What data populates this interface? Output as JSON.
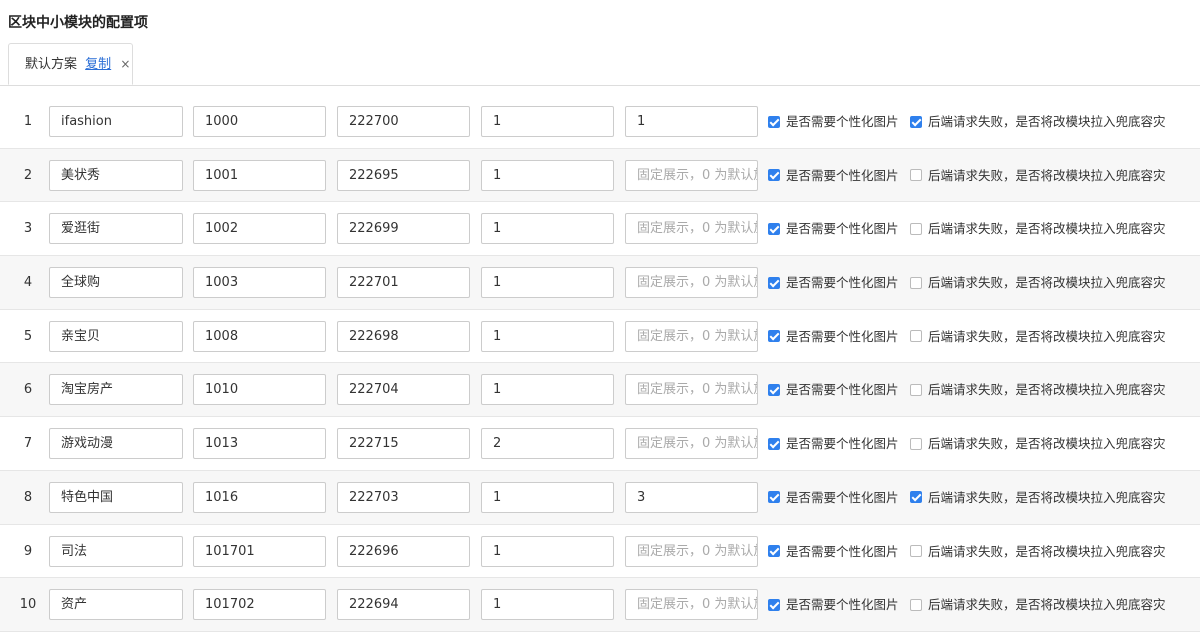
{
  "page_title": "区块中小模块的配置项",
  "tab": {
    "label": "默认方案",
    "copy_label": "复制",
    "close_label": "×"
  },
  "checkbox_labels": {
    "personalized": "是否需要个性化图片",
    "fallback": "后端请求失败，是否将改模块拉入兜底容灾"
  },
  "placeholder_fixed": "固定展示，0 为默认放",
  "rows": [
    {
      "num": "1",
      "name": "ifashion",
      "id": "1000",
      "code": "222700",
      "count": "1",
      "fixed": "1",
      "personalized": true,
      "fallback": true
    },
    {
      "num": "2",
      "name": "美状秀",
      "id": "1001",
      "code": "222695",
      "count": "1",
      "fixed": "",
      "personalized": true,
      "fallback": false
    },
    {
      "num": "3",
      "name": "爱逛街",
      "id": "1002",
      "code": "222699",
      "count": "1",
      "fixed": "",
      "personalized": true,
      "fallback": false
    },
    {
      "num": "4",
      "name": "全球购",
      "id": "1003",
      "code": "222701",
      "count": "1",
      "fixed": "",
      "personalized": true,
      "fallback": false
    },
    {
      "num": "5",
      "name": "亲宝贝",
      "id": "1008",
      "code": "222698",
      "count": "1",
      "fixed": "",
      "personalized": true,
      "fallback": false
    },
    {
      "num": "6",
      "name": "淘宝房产",
      "id": "1010",
      "code": "222704",
      "count": "1",
      "fixed": "",
      "personalized": true,
      "fallback": false
    },
    {
      "num": "7",
      "name": "游戏动漫",
      "id": "1013",
      "code": "222715",
      "count": "2",
      "fixed": "",
      "personalized": true,
      "fallback": false
    },
    {
      "num": "8",
      "name": "特色中国",
      "id": "1016",
      "code": "222703",
      "count": "1",
      "fixed": "3",
      "personalized": true,
      "fallback": true
    },
    {
      "num": "9",
      "name": "司法",
      "id": "101701",
      "code": "222696",
      "count": "1",
      "fixed": "",
      "personalized": true,
      "fallback": false
    },
    {
      "num": "10",
      "name": "资产",
      "id": "101702",
      "code": "222694",
      "count": "1",
      "fixed": "",
      "personalized": true,
      "fallback": false
    }
  ]
}
